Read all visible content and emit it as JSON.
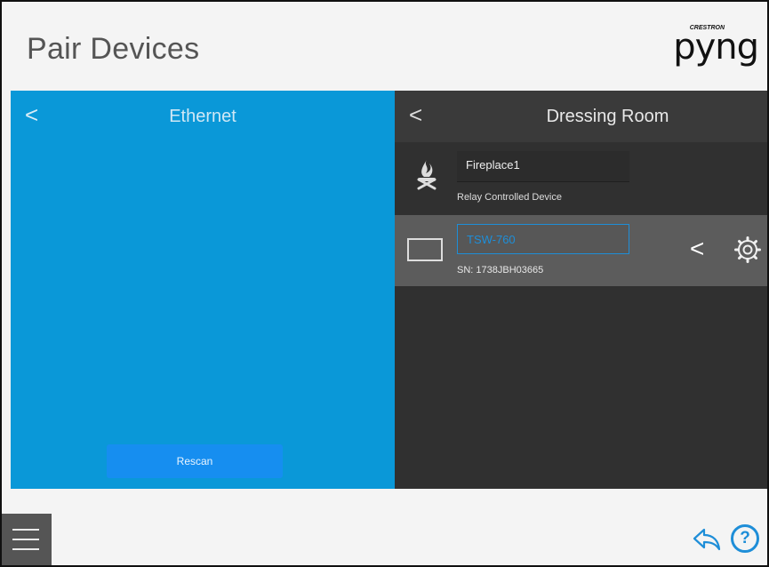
{
  "header": {
    "title": "Pair Devices",
    "logo_top": "CRESTRON",
    "logo_main": "pyng"
  },
  "left_panel": {
    "back_label": "<",
    "title": "Ethernet",
    "rescan_label": "Rescan"
  },
  "right_panel": {
    "back_label": "<",
    "title": "Dressing Room",
    "devices": [
      {
        "name": "Fireplace1",
        "subtitle": "Relay Controlled Device",
        "icon": "fireplace-icon"
      },
      {
        "name": "TSW-760",
        "subtitle": "SN: 1738JBH03665",
        "icon": "touchscreen-icon",
        "selected": true
      }
    ],
    "row_back_label": "<"
  },
  "colors": {
    "accent": "#1e8ed8",
    "left_panel_bg": "#0a98d8",
    "right_panel_bg": "#303030",
    "selected_row_bg": "#5c5c5c"
  },
  "footer": {
    "help_label": "?"
  }
}
